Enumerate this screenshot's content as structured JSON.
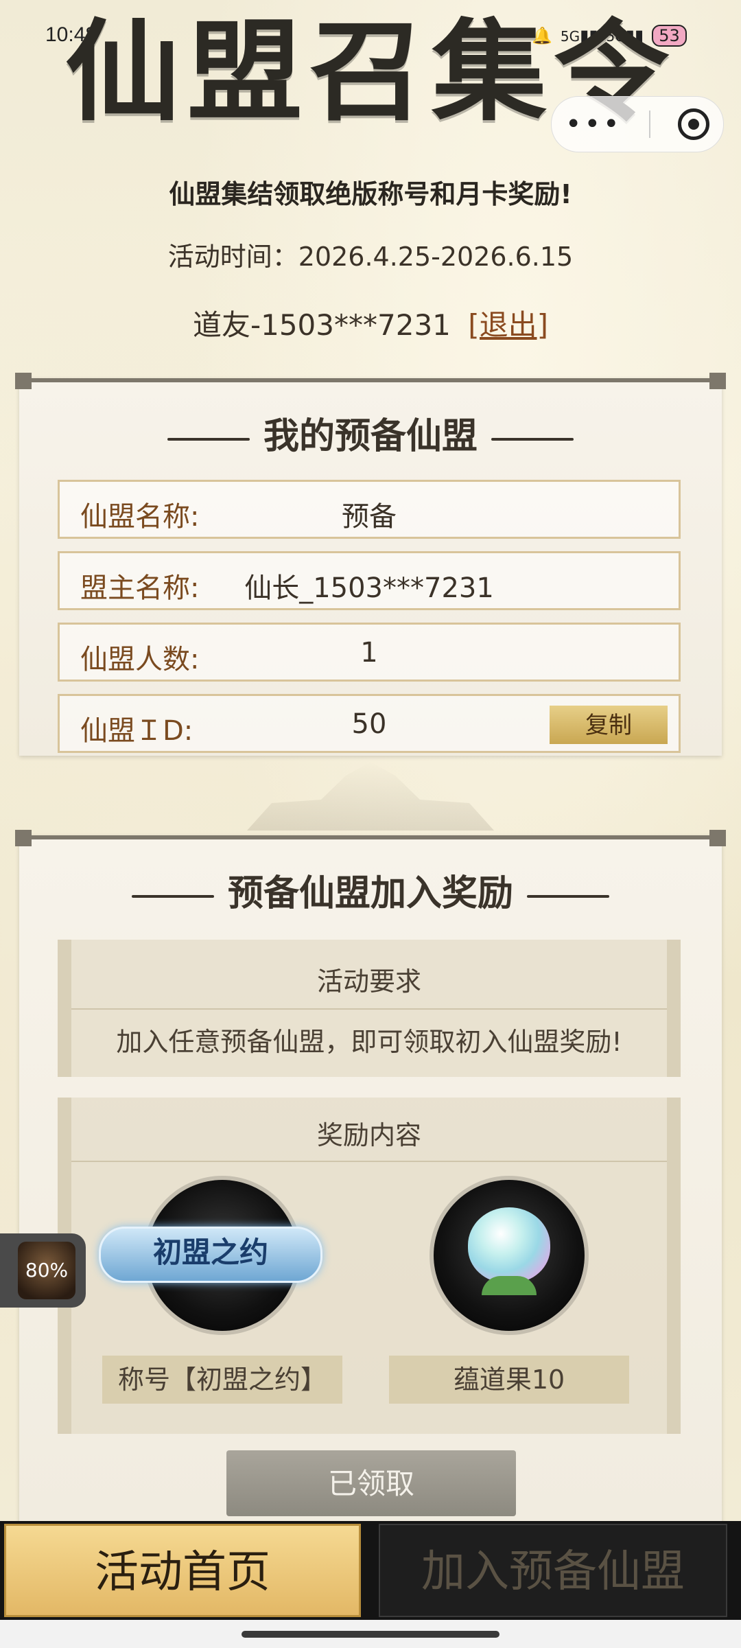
{
  "status_bar": {
    "time": "10:48",
    "signal_1": "5G",
    "signal_2": "5G",
    "battery": "53"
  },
  "header": {
    "banner_title": "仙盟召集令",
    "subtitle": "仙盟集结领取绝版称号和月卡奖励!",
    "activity_time": "活动时间：2026.4.25-2026.6.15",
    "user": "道友-1503***7231",
    "logout_label": "[退出]"
  },
  "my_alliance": {
    "title": "我的预备仙盟",
    "rows": [
      {
        "label": "仙盟名称:",
        "value": "预备"
      },
      {
        "label": "盟主名称:",
        "value": "仙长_1503***7231"
      },
      {
        "label": "仙盟人数:",
        "value": "1"
      },
      {
        "label": "仙盟ＩD:",
        "value": "50"
      }
    ],
    "copy_label": "复制"
  },
  "join_reward": {
    "title": "预备仙盟加入奖励",
    "requirement_title": "活动要求",
    "requirement_text": "加入任意预备仙盟，即可领取初入仙盟奖励!",
    "reward_title": "奖励内容",
    "rewards": [
      {
        "name": "称号【初盟之约】",
        "badge_text": "初盟之约",
        "icon": "title-badge-icon"
      },
      {
        "name": "蕴道果10",
        "icon": "dao-fruit-icon"
      }
    ],
    "claimed_label": "已领取"
  },
  "floating_widget": {
    "label": "80%"
  },
  "tabs": {
    "home": "活动首页",
    "join": "加入预备仙盟"
  },
  "colors": {
    "accent_gold": "#e3b866",
    "label_brown": "#7a4a1f",
    "tabbar_bg": "#141414"
  }
}
